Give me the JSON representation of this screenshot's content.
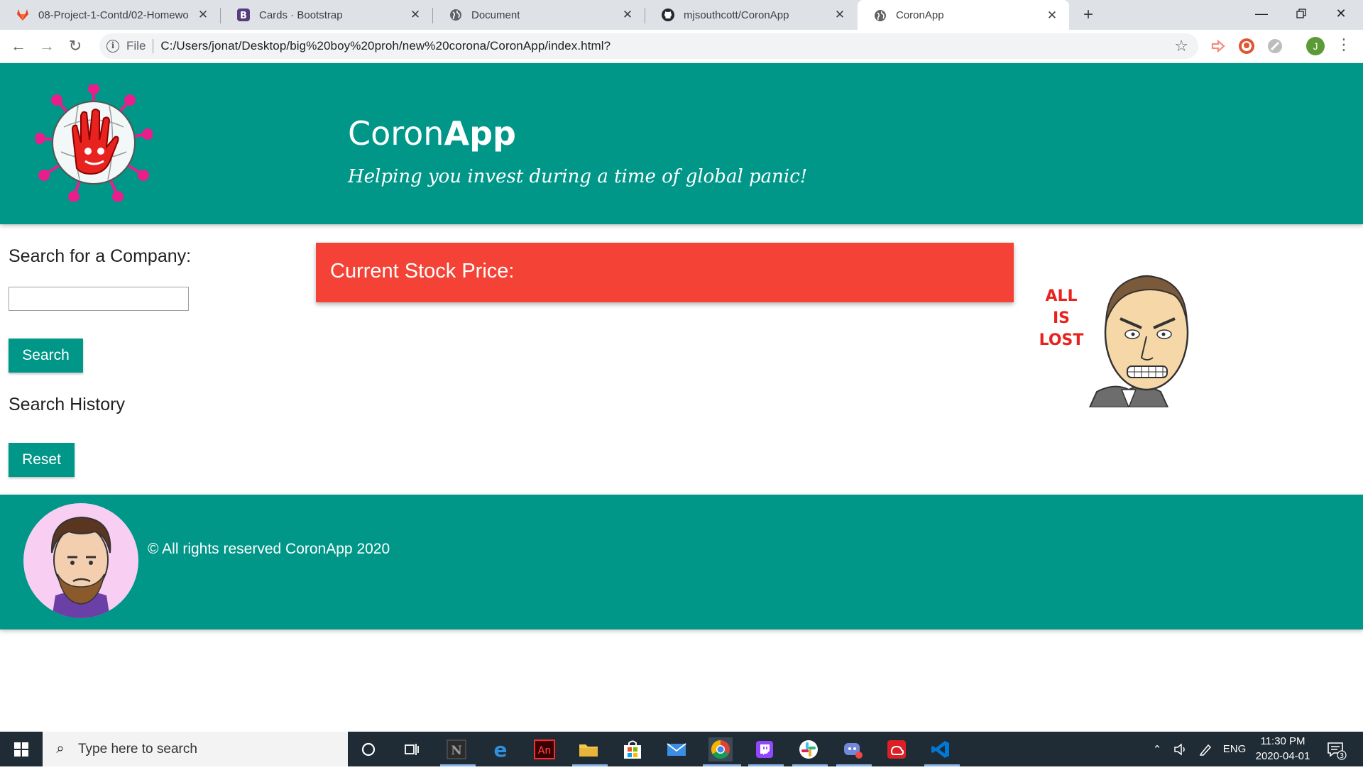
{
  "browser": {
    "tabs": [
      {
        "title": "08-Project-1-Contd/02-Homewo",
        "favicon": "gitlab-icon",
        "active": false
      },
      {
        "title": "Cards · Bootstrap",
        "favicon": "bootstrap-icon",
        "active": false
      },
      {
        "title": "Document",
        "favicon": "globe-icon",
        "active": false
      },
      {
        "title": "mjsouthcott/CoronApp",
        "favicon": "github-icon",
        "active": false
      },
      {
        "title": "CoronApp",
        "favicon": "globe-icon",
        "active": true
      }
    ],
    "new_tab": "+",
    "address": {
      "scheme_label": "File",
      "url": "C:/Users/jonat/Desktop/big%20boy%20proh/new%20corona/CoronApp/index.html?"
    },
    "profile_initial": "J"
  },
  "site": {
    "brand_light": "Coron",
    "brand_bold": "App",
    "tagline": "Helping you invest during a time of global panic!",
    "search_label": "Search for a Company:",
    "search_value": "",
    "search_button": "Search",
    "history_label": "Search History",
    "reset_button": "Reset",
    "stock_label": "Current Stock Price:",
    "meme_text": [
      "ALL",
      "IS",
      "LOST"
    ],
    "footer": "© All rights reserved CoronApp 2020"
  },
  "taskbar": {
    "search_placeholder": "Type here to search",
    "language": "ENG",
    "time": "11:30 PM",
    "date": "2020-04-01",
    "notification_count": "3"
  },
  "colors": {
    "teal": "#009688",
    "stock_red": "#f44336",
    "taskbar": "#1f2b35"
  }
}
